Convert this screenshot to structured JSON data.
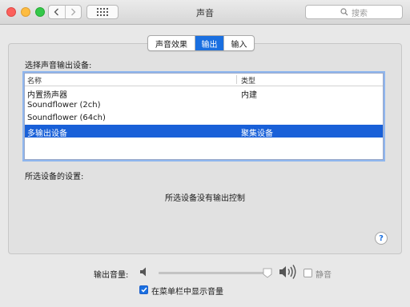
{
  "window": {
    "title": "声音"
  },
  "toolbar": {
    "search_placeholder": "搜索"
  },
  "tabs": [
    {
      "label": "声音效果",
      "selected": false
    },
    {
      "label": "输出",
      "selected": true
    },
    {
      "label": "输入",
      "selected": false
    }
  ],
  "output": {
    "device_heading": "选择声音输出设备:",
    "columns": {
      "name": "名称",
      "type": "类型"
    },
    "devices": [
      {
        "name": "内置扬声器",
        "type": "内建",
        "selected": false
      },
      {
        "name": "Soundflower (2ch)",
        "type": "",
        "selected": false
      },
      {
        "name": "Soundflower (64ch)",
        "type": "",
        "selected": false
      },
      {
        "name": "多输出设备",
        "type": "聚集设备",
        "selected": true
      }
    ],
    "settings_heading": "所选设备的设置:",
    "no_controls_message": "所选设备没有输出控制"
  },
  "help": {
    "label": "?"
  },
  "volume": {
    "label": "输出音量:",
    "level": 0.97,
    "mute_label": "静音",
    "muted": false
  },
  "menubar": {
    "label": "在菜单栏中显示音量",
    "checked": true
  },
  "colors": {
    "accent": "#1a6fe0",
    "selection": "#1960d8"
  }
}
